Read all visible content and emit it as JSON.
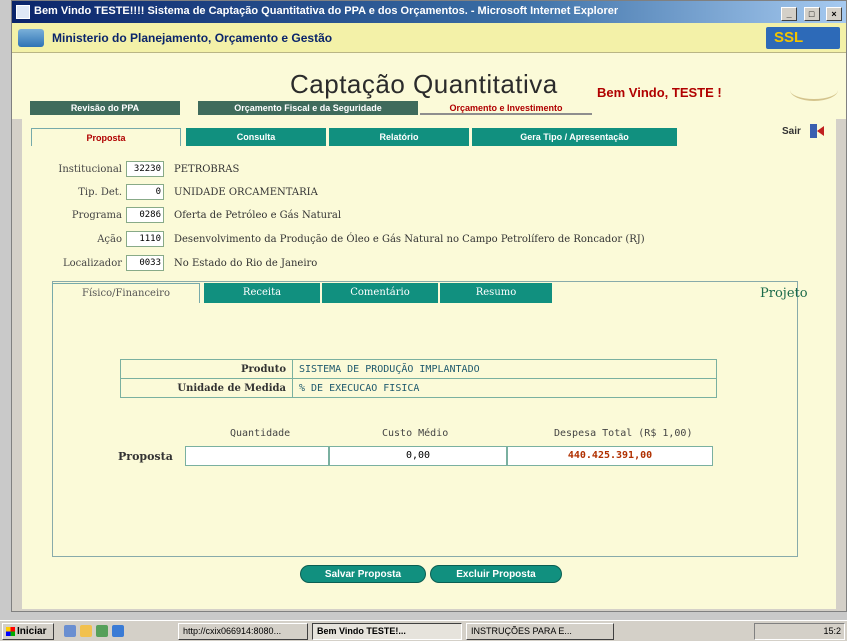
{
  "window": {
    "title": "Bem Vindo TESTE!!!! Sistema de Captação Quantitativa do PPA e dos Orçamentos. - Microsoft Internet Explorer",
    "controls": [
      "_",
      "□",
      "×"
    ]
  },
  "ministry": {
    "name": "Ministerio do Planejamento, Orçamento e Gestão"
  },
  "header": {
    "title": "Captação Quantitativa",
    "welcome": "Bem Vindo, TESTE !",
    "nav": [
      "Revisão do PPA",
      "Orçamento Fiscal e da Seguridade",
      "Orçamento e Investimento"
    ]
  },
  "main_tabs": [
    "Proposta",
    "Consulta",
    "Relatório",
    "Gera Tipo / Apresentação"
  ],
  "exit_label": "Sair",
  "fields": [
    {
      "label": "Institucional",
      "code": "32230",
      "value": "PETROBRAS"
    },
    {
      "label": "Tip. Det.",
      "code": "0",
      "value": "UNIDADE ORCAMENTARIA"
    },
    {
      "label": "Programa",
      "code": "0286",
      "value": "Oferta de Petróleo e Gás Natural"
    },
    {
      "label": "Ação",
      "code": "1110",
      "value": "Desenvolvimento da Produção de Óleo e Gás Natural no Campo Petrolífero de Roncador (RJ)"
    },
    {
      "label": "Localizador",
      "code": "0033",
      "value": "No Estado do Rio de Janeiro"
    }
  ],
  "sub_tabs": [
    "Físico/Financeiro",
    "Receita",
    "Comentário",
    "Resumo"
  ],
  "sub_title": "Projeto",
  "product": {
    "produto_label": "Produto",
    "produto_value": "SISTEMA DE PRODUÇÃO IMPLANTADO",
    "unidade_label": "Unidade de Medida",
    "unidade_value": "% DE EXECUCAO FISICA"
  },
  "values": {
    "row_label": "Proposta",
    "headers": [
      "Quantidade",
      "Custo Médio",
      "Despesa Total (R$ 1,00)"
    ],
    "quantidade": "",
    "custo_medio": "0,00",
    "despesa_total": "440.425.391,00",
    "despesa_color": "#b03000"
  },
  "buttons": {
    "save": "Salvar Proposta",
    "delete": "Excluir Proposta"
  },
  "taskbar": {
    "start": "Iniciar",
    "items": [
      "http://cxix066914:8080...",
      "Bem Vindo TESTE!...",
      "INSTRUÇÕES PARA E..."
    ],
    "clock": "15:2"
  },
  "logo_text": "SSL"
}
